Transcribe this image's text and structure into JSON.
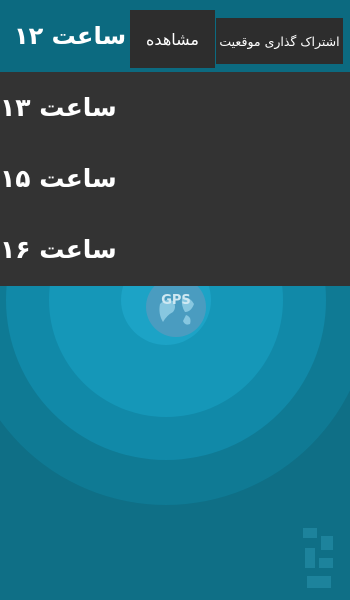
{
  "header": {
    "title": "ساعت ۱۲",
    "tabs": [
      {
        "label": "مشاهده"
      },
      {
        "label": "اشتراک گذاری موقعیت"
      }
    ]
  },
  "dropdown": {
    "items": [
      {
        "label": "ساعت ۱۳"
      },
      {
        "label": "ساعت ۱۵"
      },
      {
        "label": "ساعت ۱۶"
      }
    ]
  },
  "gps_badge": {
    "label": "GPS"
  },
  "colors": {
    "background": "#0f6f86",
    "topbar": "#0c6a80",
    "tab": "#2d2d2d",
    "dropdown": "#333333",
    "ring_outer": "#138aa8",
    "ring_mid": "#1a9bc0",
    "ring_inner": "#1ea6cb",
    "globe": "#3c8fb2"
  },
  "icons": {
    "globe": "globe-gps-icon",
    "watermark": "bazaar-watermark-icon"
  }
}
